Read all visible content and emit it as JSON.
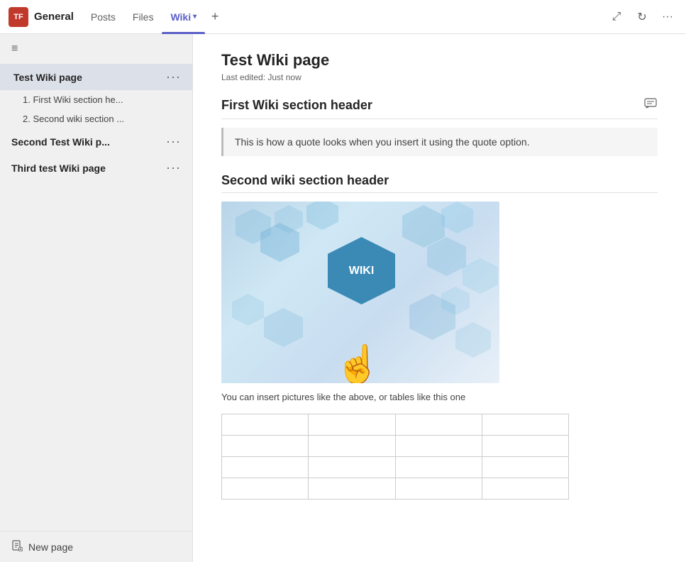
{
  "topbar": {
    "team_avatar": "TF",
    "team_name": "General",
    "tabs": [
      {
        "id": "posts",
        "label": "Posts",
        "active": false
      },
      {
        "id": "files",
        "label": "Files",
        "active": false
      },
      {
        "id": "wiki",
        "label": "Wiki",
        "active": true
      },
      {
        "id": "add",
        "label": "+",
        "active": false
      }
    ],
    "actions": {
      "expand_label": "⤢",
      "refresh_label": "↻",
      "more_label": "···"
    }
  },
  "sidebar": {
    "hamburger": "≡",
    "pages": [
      {
        "id": "test-wiki-page",
        "title": "Test Wiki page",
        "active": true,
        "sections": [
          {
            "id": "section-1",
            "label": "1. First Wiki section he..."
          },
          {
            "id": "section-2",
            "label": "2. Second wiki section ..."
          }
        ]
      },
      {
        "id": "second-test-wiki",
        "title": "Second Test Wiki p...",
        "active": false,
        "sections": []
      },
      {
        "id": "third-test-wiki",
        "title": "Third test Wiki page",
        "active": false,
        "sections": []
      }
    ],
    "new_page_icon": "🗋",
    "new_page_label": "New page"
  },
  "content": {
    "page_title": "Test Wiki page",
    "last_edited": "Last edited: Just now",
    "sections": [
      {
        "id": "first-section",
        "title": "First Wiki section header",
        "has_comment_icon": true,
        "quote": "This is how a quote looks when you insert it using the quote option."
      },
      {
        "id": "second-section",
        "title": "Second wiki section header",
        "has_comment_icon": false,
        "caption": "You can insert pictures like the above, or tables like this one"
      }
    ]
  }
}
